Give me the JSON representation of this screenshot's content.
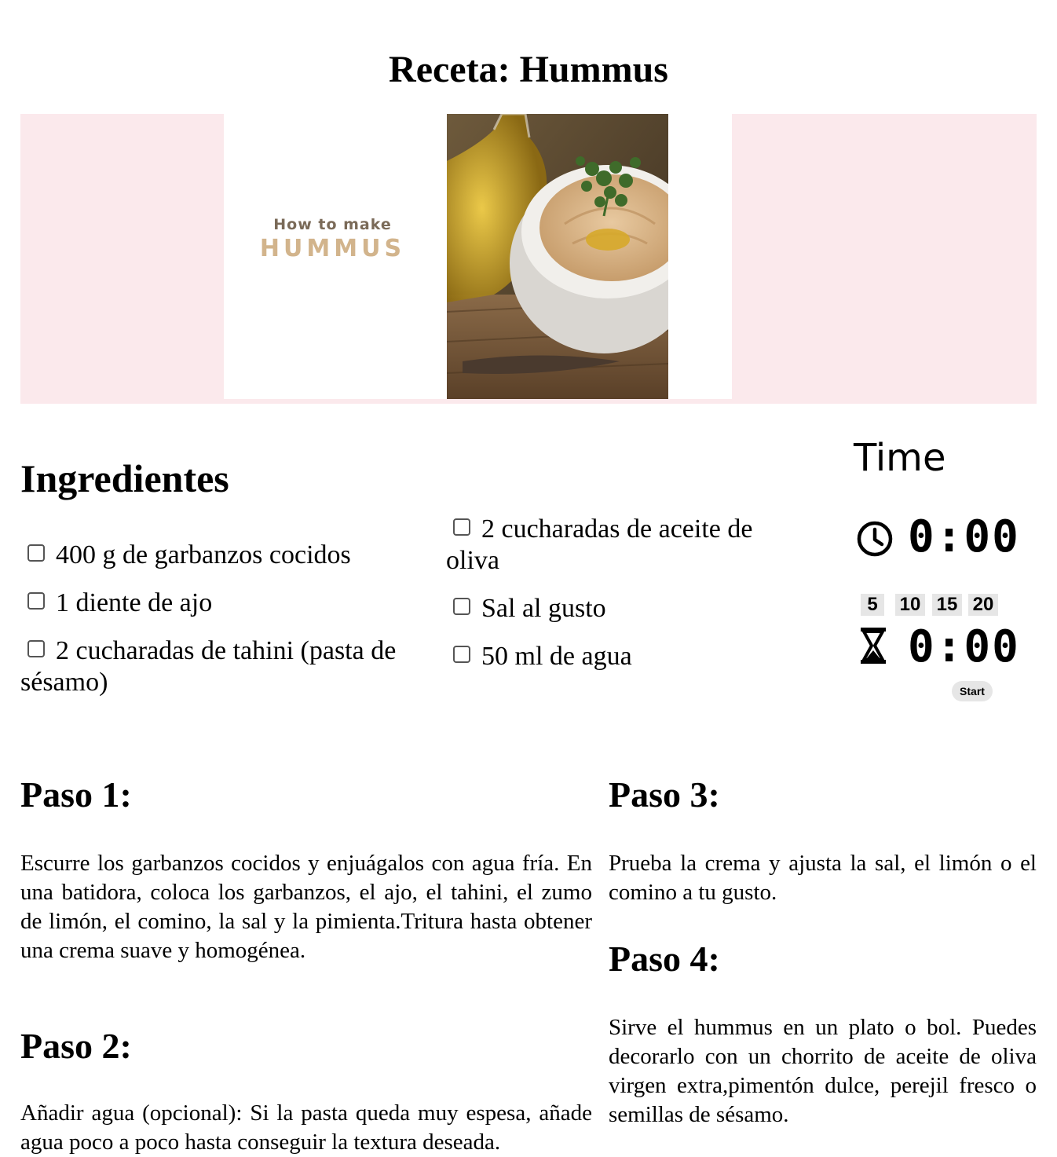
{
  "page": {
    "title": "Receta: Hummus"
  },
  "hero": {
    "line1": "How to make",
    "line2": "HUMMUS"
  },
  "ingredients": {
    "title": "Ingredientes",
    "items": [
      "400 g de garbanzos cocidos",
      "1 diente de ajo",
      "2 cucharadas de tahini (pasta de sésamo)",
      "2 cucharadas de aceite de oliva",
      "Sal al gusto",
      "50 ml de agua"
    ]
  },
  "timer": {
    "title": "Time",
    "clock_value": "0:00",
    "countdown_value": "0:00",
    "presets": [
      "5",
      "10",
      "15",
      "20"
    ],
    "start_label": "Start"
  },
  "steps": [
    {
      "title": "Paso 1:",
      "text": "Escurre los garbanzos cocidos y enjuágalos con agua fría. En una batidora, coloca los garbanzos, el ajo, el tahini, el zumo de limón, el comino, la sal y la pimienta.Tritura hasta obtener una crema suave y homogénea."
    },
    {
      "title": "Paso 2:",
      "text": "Añadir agua (opcional): Si la pasta queda muy espesa, añade agua poco a poco hasta conseguir la textura deseada."
    },
    {
      "title": "Paso 3:",
      "text": "Prueba la crema y ajusta la sal, el limón o el comino a tu gusto."
    },
    {
      "title": "Paso 4:",
      "text": "Sirve el hummus en un plato o bol. Puedes decorarlo con un chorrito de aceite de oliva virgen extra,pimentón dulce, perejil fresco o semillas de sésamo."
    }
  ]
}
